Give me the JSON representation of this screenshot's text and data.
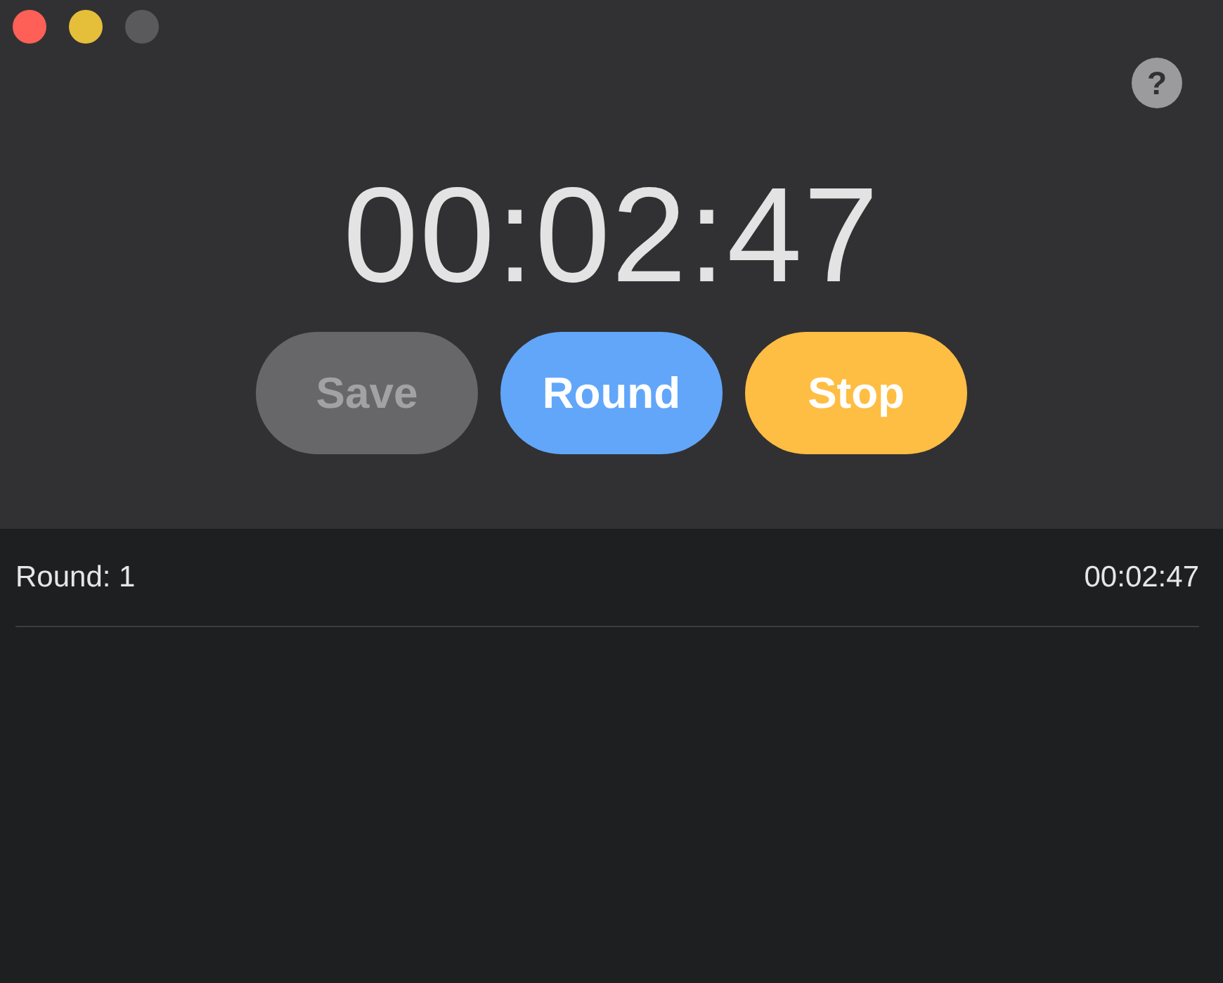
{
  "window_controls": [
    {
      "color": "#fe5f57"
    },
    {
      "color": "#e6bf3a"
    },
    {
      "color": "#5a5a5c"
    }
  ],
  "help_button": {
    "label": "?"
  },
  "timer": "00:02:47",
  "buttons": [
    {
      "label": "Save",
      "kind": "save",
      "disabled": true
    },
    {
      "label": "Round",
      "kind": "round",
      "disabled": false
    },
    {
      "label": "Stop",
      "kind": "stop",
      "disabled": false
    }
  ],
  "rounds": [
    {
      "label": "Round: 1",
      "time": "00:02:47"
    }
  ]
}
